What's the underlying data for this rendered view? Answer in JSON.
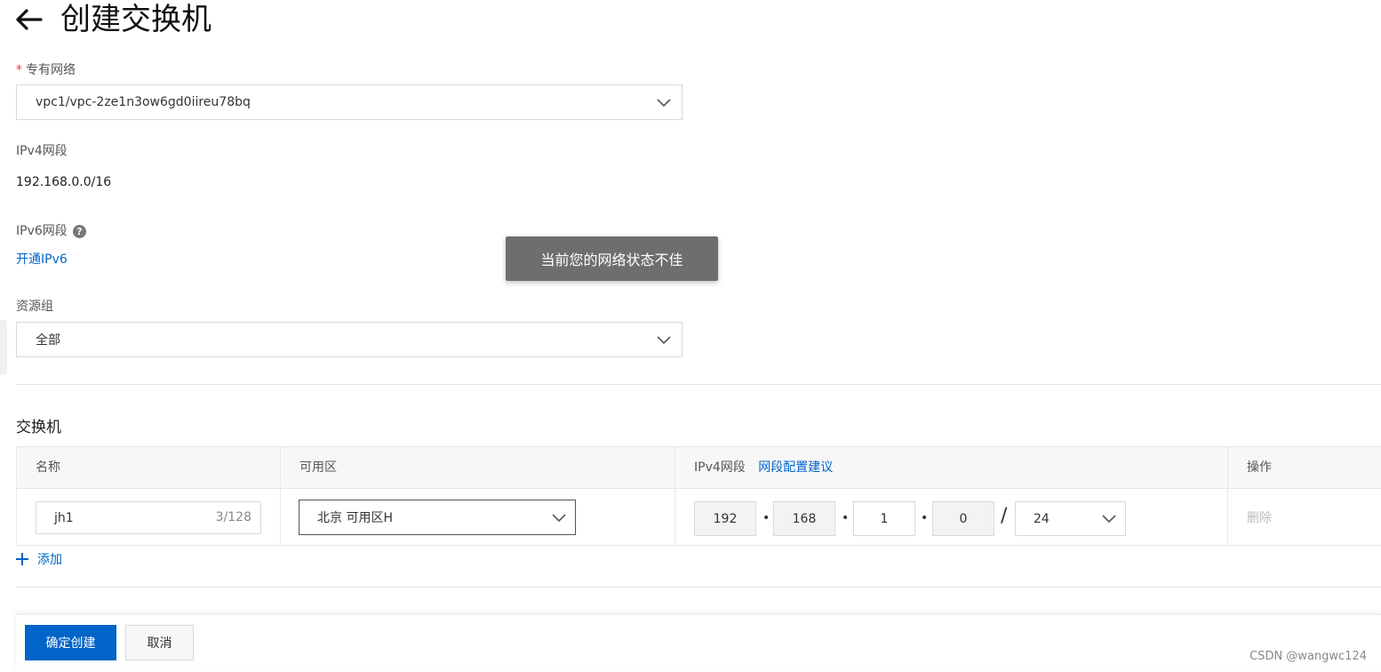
{
  "header": {
    "title": "创建交换机",
    "back_icon": "arrow-left-icon"
  },
  "vpc": {
    "label": "专有网络",
    "required_mark": "*",
    "value": "vpc1/vpc-2ze1n3ow6gd0iireu78bq"
  },
  "ipv4": {
    "label": "IPv4网段",
    "value": "192.168.0.0/16"
  },
  "ipv6": {
    "label": "IPv6网段",
    "help_glyph": "?",
    "enable_link": "开通IPv6"
  },
  "resource_group": {
    "label": "资源组",
    "value": "全部"
  },
  "switch_section": {
    "title": "交换机",
    "columns": {
      "name": "名称",
      "zone": "可用区",
      "ipv4": "IPv4网段",
      "ipv4_link": "网段配置建议",
      "action": "操作"
    },
    "rows": [
      {
        "name": "jh1",
        "name_counter": "3/128",
        "zone": "北京 可用区H",
        "octets": [
          "192",
          "168",
          "1",
          "0"
        ],
        "mask": "24",
        "delete_label": "删除"
      }
    ],
    "add_label": "添加"
  },
  "footer": {
    "confirm_label": "确定创建",
    "cancel_label": "取消"
  },
  "toast": {
    "message": "当前您的网络状态不佳"
  },
  "watermark": "CSDN @wangwc124",
  "colors": {
    "primary": "#0064c8",
    "required": "#e4393c",
    "toast_bg": "#6e6e6e"
  }
}
